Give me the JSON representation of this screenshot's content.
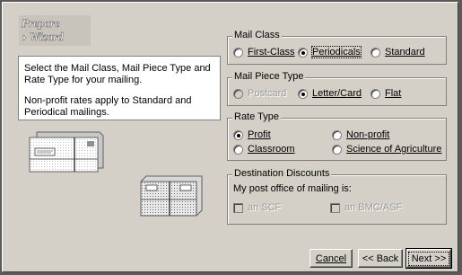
{
  "logo": {
    "line1": "Prepare",
    "line2": "Wizard"
  },
  "info": {
    "line1": "Select the Mail Class, Mail Piece Type and Rate Type for your mailing.",
    "line2": "Non-profit rates apply to Standard and Periodical mailings."
  },
  "mail_class": {
    "legend": "Mail Class",
    "options": [
      {
        "label": "First-Class",
        "selected": false
      },
      {
        "label": "Periodicals",
        "selected": true
      },
      {
        "label": "Standard",
        "selected": false
      }
    ]
  },
  "mail_piece_type": {
    "legend": "Mail Piece Type",
    "options": [
      {
        "label": "Postcard",
        "selected": false,
        "enabled": false
      },
      {
        "label": "Letter/Card",
        "selected": true,
        "enabled": true
      },
      {
        "label": "Flat",
        "selected": false,
        "enabled": true
      }
    ]
  },
  "rate_type": {
    "legend": "Rate Type",
    "options": [
      {
        "label": "Profit",
        "selected": true
      },
      {
        "label": "Non-profit",
        "selected": false
      },
      {
        "label": "Classroom",
        "selected": false
      },
      {
        "label": "Science of Agriculture",
        "selected": false
      }
    ]
  },
  "destination_discounts": {
    "legend": "Destination Discounts",
    "prompt": "My post office of mailing is:",
    "options": [
      {
        "label": "an SCF",
        "checked": false,
        "enabled": false
      },
      {
        "label": "an BMC/ASF",
        "checked": false,
        "enabled": false
      }
    ]
  },
  "buttons": {
    "cancel": "Cancel",
    "back": "<< Back",
    "next": "Next >>"
  },
  "icons": {
    "logo": "prepare-wizard-logo",
    "letters": "stacked-letters-icon",
    "flats": "stacked-flats-icon"
  }
}
